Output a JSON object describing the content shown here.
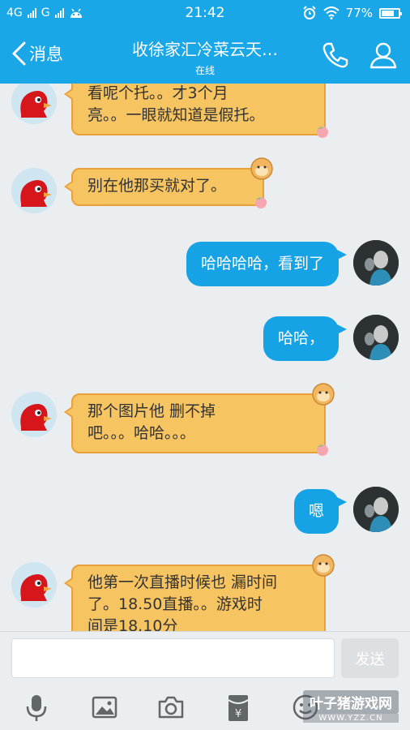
{
  "status_bar": {
    "network1": "4G",
    "network2": "G",
    "time": "21:42",
    "battery": "77%",
    "battery_level": 0.77
  },
  "header": {
    "back_label": "消息",
    "contact_name": "收徐家汇冷菜云天…",
    "contact_status": "在线",
    "icons": [
      "chevron-left-icon",
      "phone-icon",
      "person-icon"
    ]
  },
  "messages": [
    {
      "side": "left",
      "lines": [
        "看呢个托。。才3个月",
        "亮。。一眼就知道是假托。"
      ]
    },
    {
      "side": "left",
      "lines": [
        "别在他那买就对了。"
      ]
    },
    {
      "side": "right",
      "lines": [
        "哈哈哈哈，看到了"
      ]
    },
    {
      "side": "right",
      "lines": [
        "哈哈，"
      ]
    },
    {
      "side": "left",
      "lines": [
        "那个图片他 删不掉",
        "吧。。。哈哈。。。"
      ]
    },
    {
      "side": "right",
      "lines": [
        "嗯"
      ]
    },
    {
      "side": "left",
      "lines": [
        "他第一次直播时候也 漏时间",
        "了。18.50直播。。游戏时",
        "间是18.10分"
      ]
    }
  ],
  "input": {
    "placeholder": "",
    "send_label": "发送"
  },
  "toolbar": {
    "icons": [
      "microphone-icon",
      "image-icon",
      "camera-icon",
      "red-packet-icon",
      "emoji-icon"
    ]
  },
  "watermark": {
    "title": "叶子猪游戏网",
    "url": "WWW.YZZ.CN"
  },
  "colors": {
    "accent": "#1aa7e8",
    "left_bubble": "#f7c462",
    "left_bubble_border": "#e9a03a",
    "right_bubble": "#16a3e6",
    "background": "#ebeef0"
  }
}
